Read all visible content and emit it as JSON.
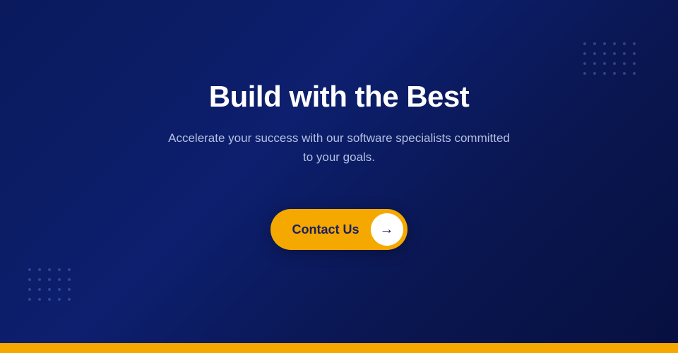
{
  "hero": {
    "title": "Build with the Best",
    "subtitle_line1": "Accelerate your success with our software specialists committed",
    "subtitle_line2": "to your goals.",
    "subtitle": "Accelerate your success with our software specialists committed to your goals.",
    "cta_label": "Contact Us",
    "arrow": "→"
  },
  "colors": {
    "background_start": "#0a1a5c",
    "background_end": "#071040",
    "text_primary": "#ffffff",
    "text_secondary": "rgba(200,210,240,0.9)",
    "cta_bg": "#f5a800",
    "cta_text": "#1a2060",
    "bottom_bar": "#f5a800",
    "dot_color": "rgba(100,130,220,0.4)"
  },
  "dots": {
    "top_right_cols": 6,
    "top_right_rows": 4,
    "bottom_left_cols": 5,
    "bottom_left_rows": 4
  }
}
